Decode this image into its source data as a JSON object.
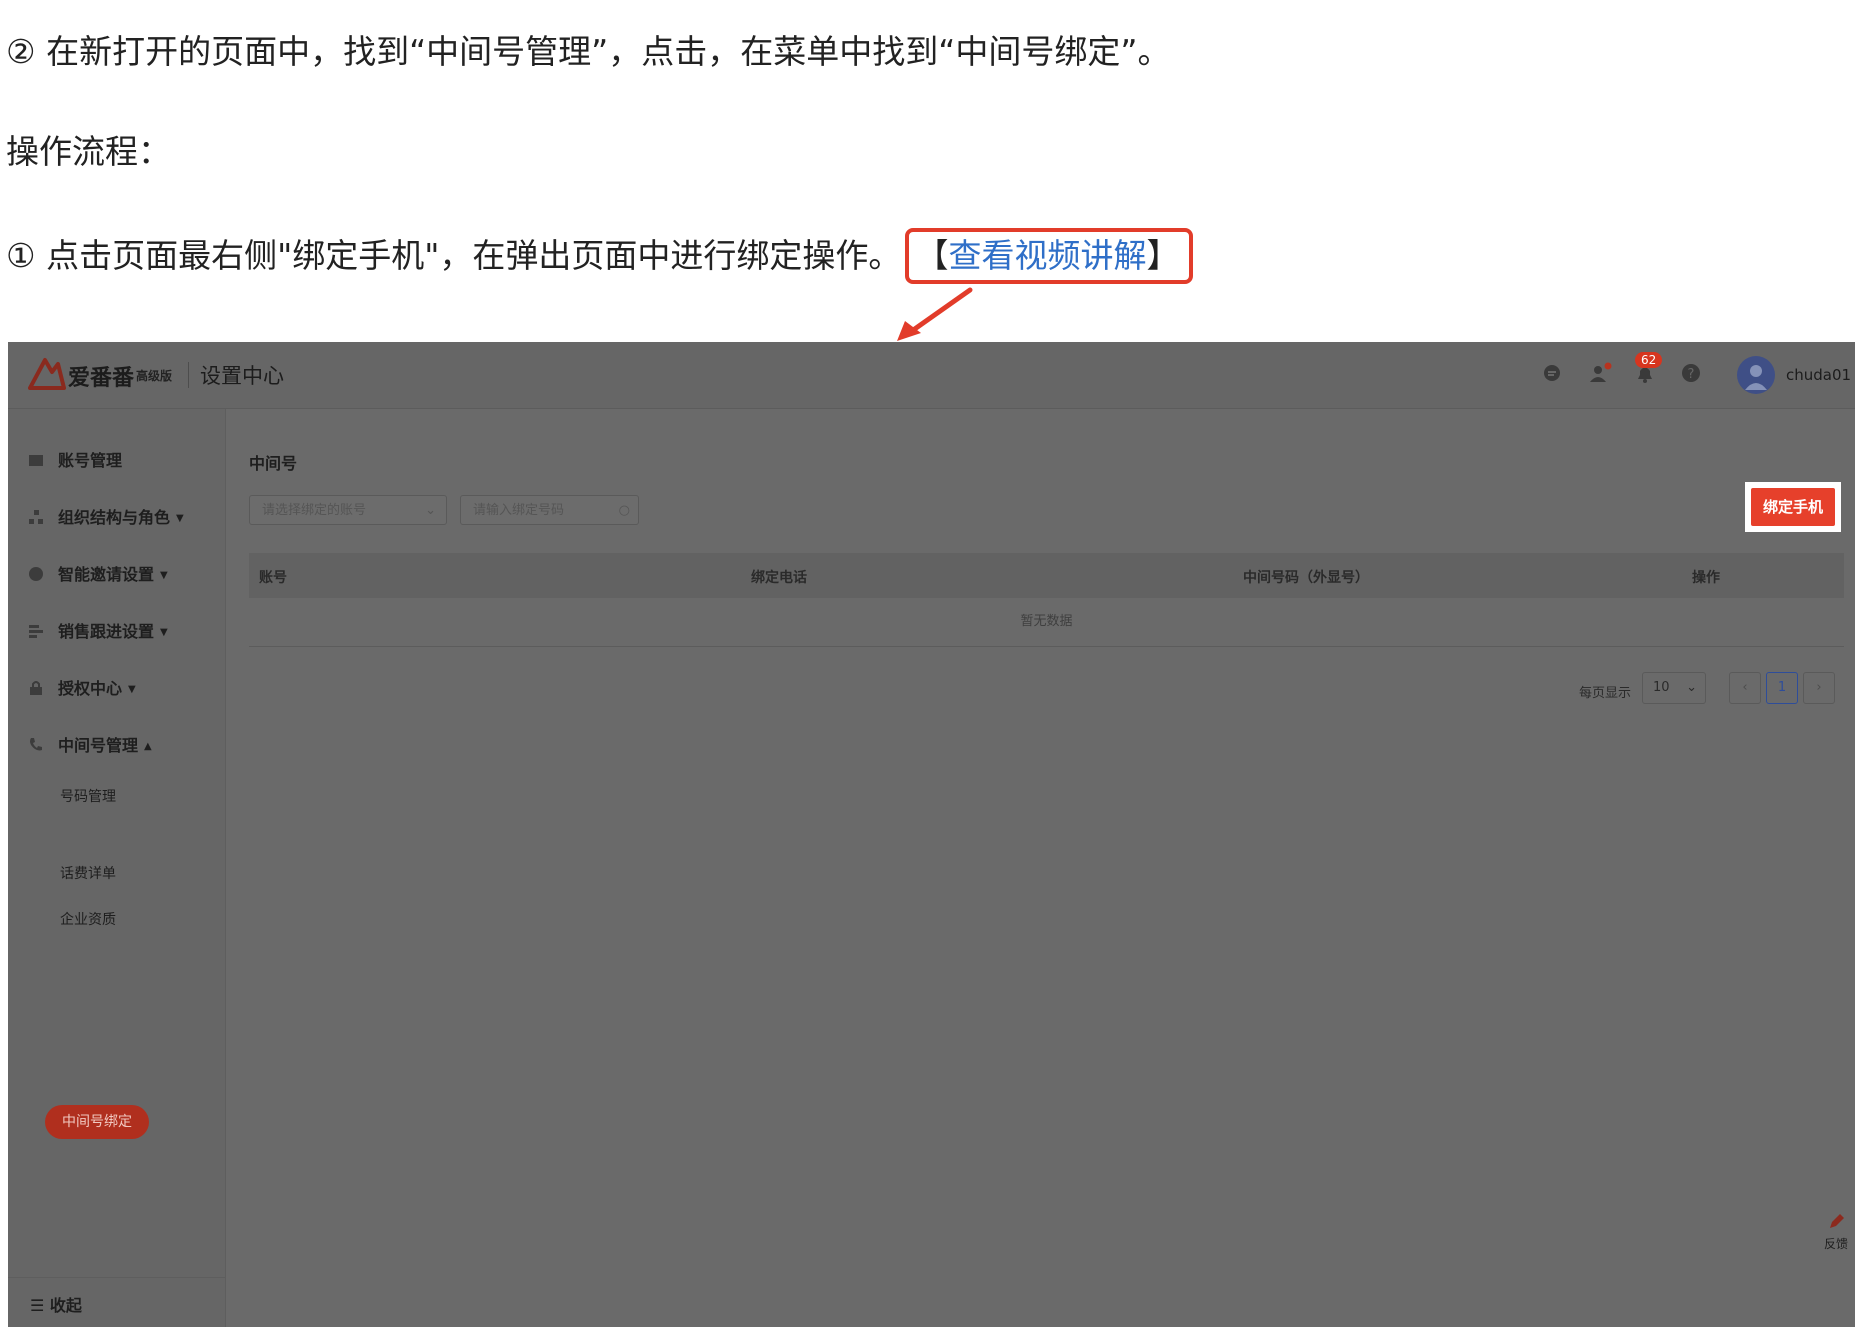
{
  "doc": {
    "step2": "② 在新打开的页面中，找到“中间号管理”，点击，在菜单中找到“中间号绑定”。",
    "flow_title": "操作流程：",
    "step1_text": "① 点击页面最右侧\"绑定手机\"，在弹出页面中进行绑定操作。",
    "video_link_open": "【",
    "video_link": "查看视频讲解",
    "video_link_close": "】"
  },
  "app": {
    "brand": "爱番番",
    "edition": "高级版",
    "section_title": "设置中心",
    "notification_count": "62",
    "username": "chuda01"
  },
  "sidebar": {
    "items": [
      {
        "label": "账号管理",
        "icon": "folder-icon"
      },
      {
        "label": "组织结构与角色",
        "icon": "org-chart-icon"
      },
      {
        "label": "智能邀请设置",
        "icon": "invite-icon"
      },
      {
        "label": "销售跟进设置",
        "icon": "list-icon"
      },
      {
        "label": "授权中心",
        "icon": "lock-icon"
      },
      {
        "label": "中间号管理",
        "icon": "phone-icon"
      }
    ],
    "sub_items": [
      "号码管理",
      "中间号绑定",
      "话费详单",
      "企业资质"
    ],
    "collapse_label": "收起"
  },
  "content": {
    "title": "中间号",
    "select_placeholder": "请选择绑定的账号",
    "search_placeholder": "请输入绑定号码",
    "bind_button": "绑定手机",
    "columns": [
      "账号",
      "绑定电话",
      "中间号码（外显号）",
      "操作"
    ],
    "empty_text": "暂无数据",
    "pager": {
      "label": "每页显示",
      "page_size": "10",
      "current_page": "1"
    },
    "feedback_label": "反馈"
  },
  "colors": {
    "accent_red": "#e6402b",
    "link_blue": "#2f6fc8",
    "overlay_gray": "#6a6a6a"
  }
}
